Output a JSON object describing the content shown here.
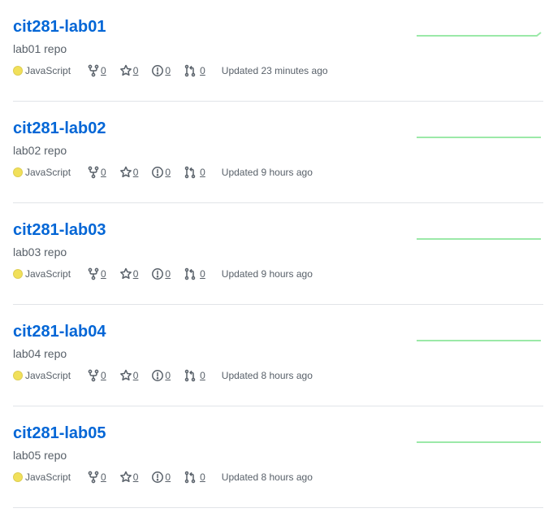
{
  "theme": {
    "link_color": "#0366d6",
    "javascript_color": "#f1e05a",
    "sparkline_color": "#9be9a8"
  },
  "repos": [
    {
      "name": "cit281-lab01",
      "description": "lab01 repo",
      "language": "JavaScript",
      "forks": "0",
      "stars": "0",
      "issues": "0",
      "pulls": "0",
      "updated": "Updated 23 minutes ago"
    },
    {
      "name": "cit281-lab02",
      "description": "lab02 repo",
      "language": "JavaScript",
      "forks": "0",
      "stars": "0",
      "issues": "0",
      "pulls": "0",
      "updated": "Updated 9 hours ago"
    },
    {
      "name": "cit281-lab03",
      "description": "lab03 repo",
      "language": "JavaScript",
      "forks": "0",
      "stars": "0",
      "issues": "0",
      "pulls": "0",
      "updated": "Updated 9 hours ago"
    },
    {
      "name": "cit281-lab04",
      "description": "lab04 repo",
      "language": "JavaScript",
      "forks": "0",
      "stars": "0",
      "issues": "0",
      "pulls": "0",
      "updated": "Updated 8 hours ago"
    },
    {
      "name": "cit281-lab05",
      "description": "lab05 repo",
      "language": "JavaScript",
      "forks": "0",
      "stars": "0",
      "issues": "0",
      "pulls": "0",
      "updated": "Updated 8 hours ago"
    }
  ]
}
